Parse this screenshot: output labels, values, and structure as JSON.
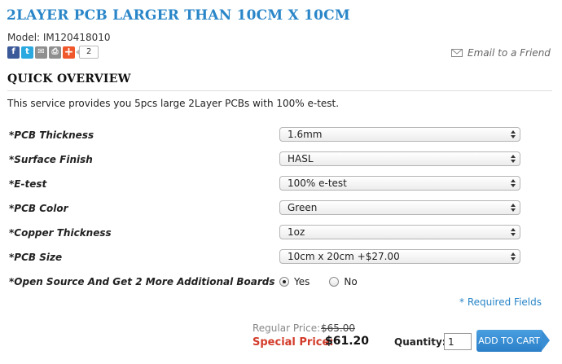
{
  "product": {
    "title": "2LAYER PCB LARGER THAN 10CM X 10CM",
    "model": "Model: IM120418010"
  },
  "share": {
    "icons": [
      "facebook-icon",
      "twitter-icon",
      "email-icon",
      "print-icon",
      "plus-icon"
    ],
    "count": "2",
    "email_friend": "Email to a Friend"
  },
  "overview": {
    "heading": "QUICK OVERVIEW",
    "description": "This service provides you 5pcs large 2Layer PCBs with 100% e-test."
  },
  "options": [
    {
      "label": "*PCB Thickness",
      "value": "1.6mm"
    },
    {
      "label": "*Surface Finish",
      "value": "HASL"
    },
    {
      "label": "*E-test",
      "value": "100% e-test"
    },
    {
      "label": "*PCB Color",
      "value": "Green"
    },
    {
      "label": "*Copper Thickness",
      "value": "1oz"
    },
    {
      "label": "*PCB Size",
      "value": "10cm x 20cm +$27.00"
    }
  ],
  "open_source": {
    "label": "*Open Source And Get 2 More Additional Boards",
    "yes": "Yes",
    "no": "No",
    "selected": "Yes"
  },
  "required_note": "* Required Fields",
  "price": {
    "regular_label": "Regular Price:",
    "regular_value": "$65.00",
    "special_label": "Special Price:",
    "special_value": "$61.20"
  },
  "cart": {
    "quantity_label": "Quantity:",
    "quantity_value": "1",
    "button_label": "ADD TO CART"
  },
  "colors": {
    "accent": "#2a86c8",
    "special_price": "#d33b2a"
  }
}
